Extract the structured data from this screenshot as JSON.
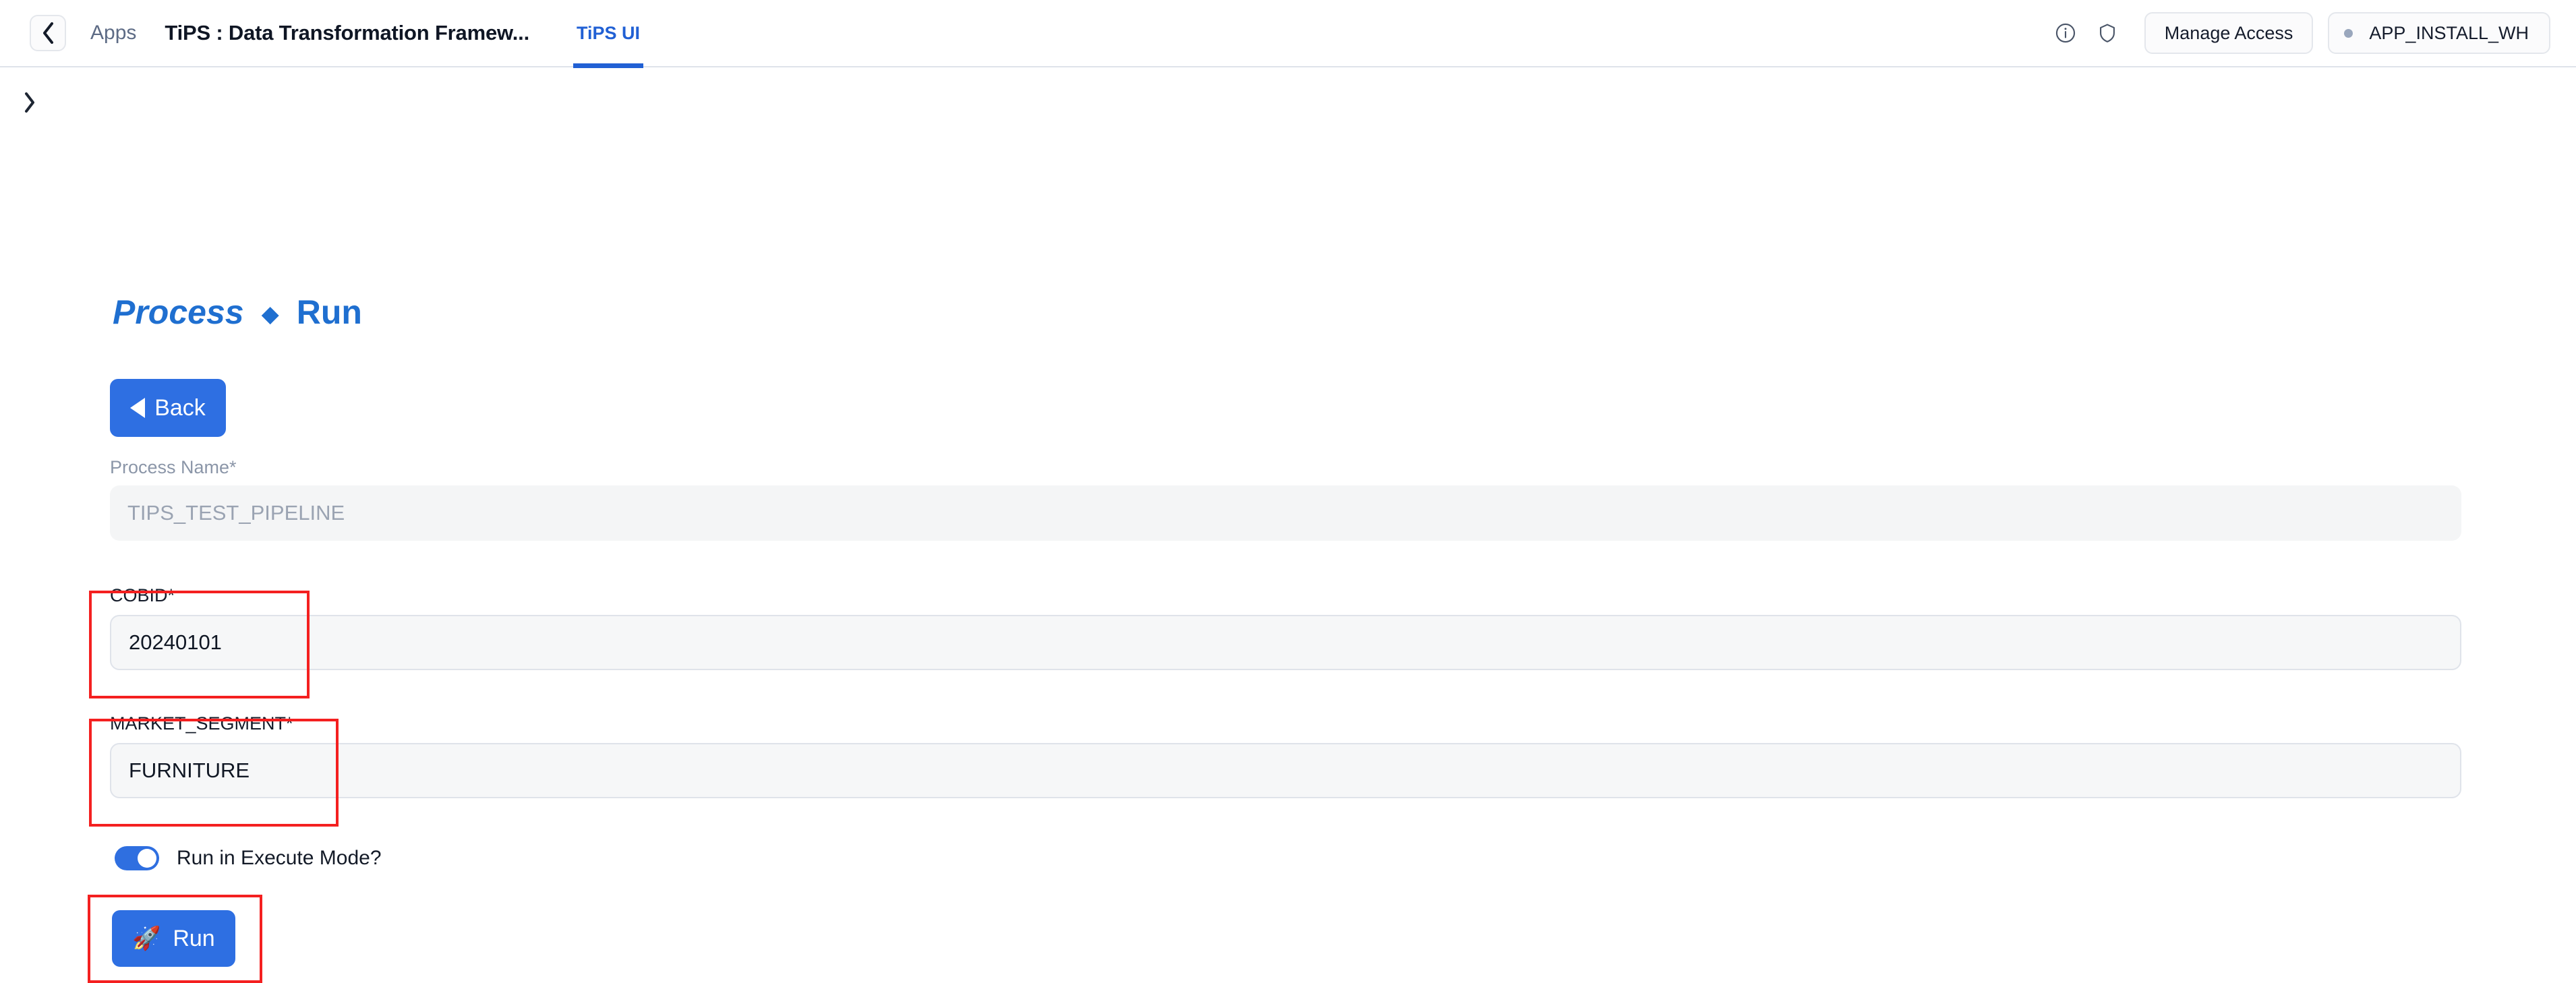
{
  "header": {
    "back_icon": "chevron-left-icon",
    "breadcrumb_apps": "Apps",
    "app_title": "TiPS : Data Transformation Framew...",
    "tabs": [
      {
        "label": "TiPS UI",
        "active": true
      }
    ],
    "info_icon": "info-circle-icon",
    "shield_icon": "shield-icon",
    "manage_access_label": "Manage Access",
    "warehouse_label": "APP_INSTALL_WH",
    "warehouse_dot_color": "#9aa7bd"
  },
  "sidebar": {
    "expand_icon": "chevron-right-icon"
  },
  "page": {
    "title_italic": "Process",
    "title_separator": "◆",
    "title_plain": "Run",
    "title_color": "#1f6fd0",
    "back_button_label": "Back",
    "back_button_icon": "triangle-left-icon",
    "back_button_color": "#2e6fe2"
  },
  "form": {
    "fields": [
      {
        "label": "Process Name*",
        "value": "TIPS_TEST_PIPELINE",
        "disabled": true,
        "highlighted": false
      },
      {
        "label": "COBID*",
        "value": "20240101",
        "disabled": false,
        "highlighted": true
      },
      {
        "label": "MARKET_SEGMENT*",
        "value": "FURNITURE",
        "disabled": false,
        "highlighted": true
      }
    ],
    "toggle": {
      "label": "Run in Execute Mode?",
      "on": true,
      "on_color": "#2f6fe0"
    },
    "run_button": {
      "label": "Run",
      "icon": "🚀",
      "color": "#2e6fe2",
      "highlighted": true
    },
    "annotation_color": "#f42020"
  }
}
